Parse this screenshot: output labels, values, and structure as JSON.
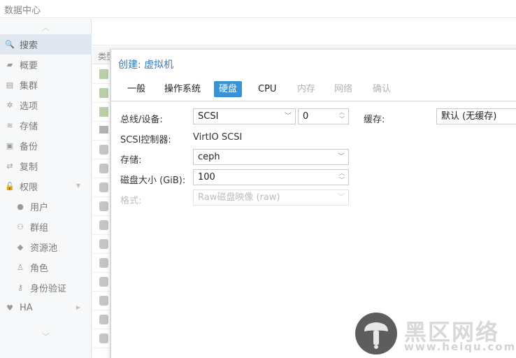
{
  "header": {
    "title": "数据中心"
  },
  "sidebar": {
    "scroll_up": "︿",
    "scroll_down": "﹀",
    "items": [
      {
        "label": "搜索",
        "icon": "search-icon",
        "glyph": "🔍"
      },
      {
        "label": "概要",
        "icon": "book-icon",
        "glyph": "▰"
      },
      {
        "label": "集群",
        "icon": "server-icon",
        "glyph": "▤"
      },
      {
        "label": "选项",
        "icon": "gear-icon",
        "glyph": "✲"
      },
      {
        "label": "存储",
        "icon": "database-icon",
        "glyph": "≋"
      },
      {
        "label": "备份",
        "icon": "floppy-icon",
        "glyph": "▣"
      },
      {
        "label": "复制",
        "icon": "retweet-icon",
        "glyph": "⇄"
      },
      {
        "label": "权限",
        "icon": "unlock-icon",
        "glyph": "🔓"
      },
      {
        "label": "用户",
        "icon": "user-icon",
        "glyph": "●"
      },
      {
        "label": "群组",
        "icon": "users-icon",
        "glyph": "⚇"
      },
      {
        "label": "资源池",
        "icon": "tags-icon",
        "glyph": "◆"
      },
      {
        "label": "角色",
        "icon": "male-icon",
        "glyph": "♙"
      },
      {
        "label": "身份验证",
        "icon": "key-icon",
        "glyph": "⚷"
      },
      {
        "label": "HA",
        "icon": "heartbeat-icon",
        "glyph": "♥"
      }
    ]
  },
  "grid": {
    "column_title": "类型"
  },
  "dialog": {
    "title": "创建: 虚拟机",
    "tabs": [
      {
        "label": "一般",
        "state": "normal"
      },
      {
        "label": "操作系统",
        "state": "normal"
      },
      {
        "label": "硬盘",
        "state": "active"
      },
      {
        "label": "CPU",
        "state": "normal"
      },
      {
        "label": "内存",
        "state": "disabled"
      },
      {
        "label": "网络",
        "state": "disabled"
      },
      {
        "label": "确认",
        "state": "disabled"
      }
    ],
    "form": {
      "bus_label": "总线/设备:",
      "bus_value": "SCSI",
      "device_index": "0",
      "cache_label": "缓存:",
      "cache_value": "默认 (无缓存)",
      "scsi_controller_label": "SCSI控制器:",
      "scsi_controller_value": "VirtIO SCSI",
      "storage_label": "存储:",
      "storage_value": "ceph",
      "disk_size_label": "磁盘大小 (GiB):",
      "disk_size_value": "100",
      "format_label": "格式:",
      "format_value": "Raw磁盘映像 (raw)"
    }
  },
  "watermark": {
    "cn": "黑区网络",
    "en": "www.heiqu.com"
  },
  "colors": {
    "accent": "#3892d4",
    "title": "#3a7bbf",
    "sidebar_bg": "#f7f8f9",
    "active_nav": "#dfe8f1"
  }
}
